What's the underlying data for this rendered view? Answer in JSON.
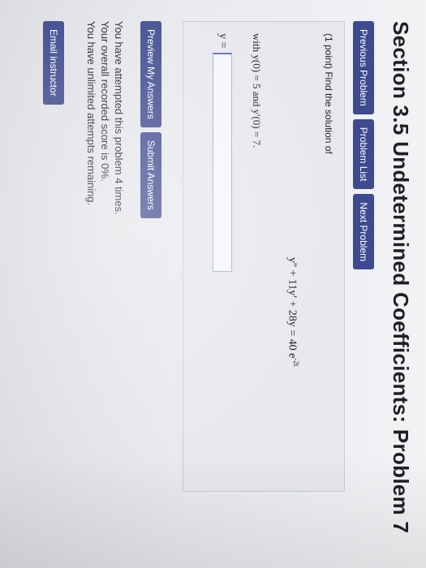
{
  "page": {
    "title": "Section 3.5 Undetermined Coefficients: Problem 7"
  },
  "nav": {
    "previous": "Previous Problem",
    "list": "Problem List",
    "next": "Next Problem"
  },
  "problem": {
    "prompt": "(1 point) Find the solution of",
    "equation_main": "y'' + 11y' + 28y = 40 e",
    "equation_exponent": "-2t",
    "initial_conditions": "with y(0) = 5 and y'(0) = 7.",
    "answer_label": "y =",
    "answer_value": ""
  },
  "actions": {
    "preview": "Preview My Answers",
    "submit": "Submit Answers"
  },
  "status": {
    "attempts": "You have attempted this problem 4 times.",
    "score": "Your overall recorded score is 0%.",
    "remaining": "You have unlimited attempts remaining."
  },
  "footer": {
    "email": "Email instructor"
  },
  "colors": {
    "button": "#3e4a8f",
    "panel": "#e6e8ee"
  }
}
